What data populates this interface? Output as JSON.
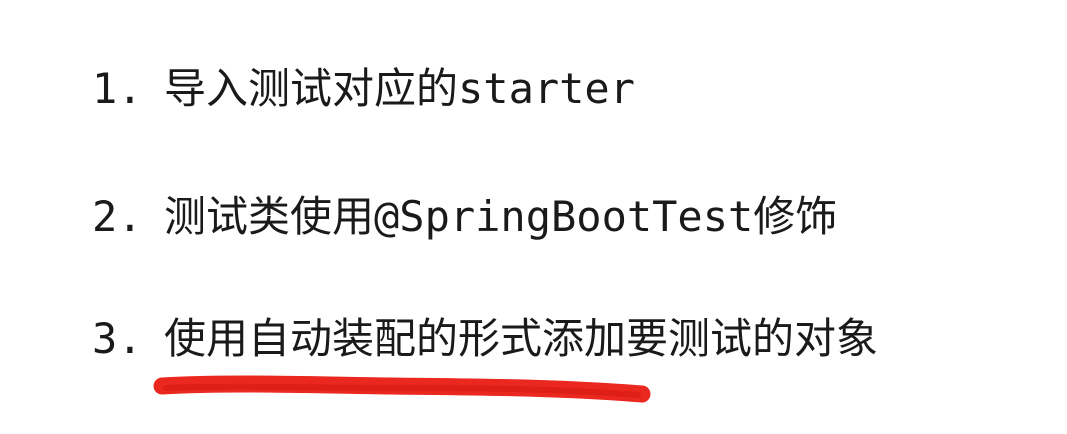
{
  "slide": {
    "items": [
      {
        "number": "1.",
        "text": "导入测试对应的starter"
      },
      {
        "number": "2.",
        "text": "测试类使用@SpringBootTest修饰"
      },
      {
        "number": "3.",
        "text": "使用自动装配的形式添加要测试的对象"
      }
    ],
    "highlight_color": "#e8160c"
  }
}
